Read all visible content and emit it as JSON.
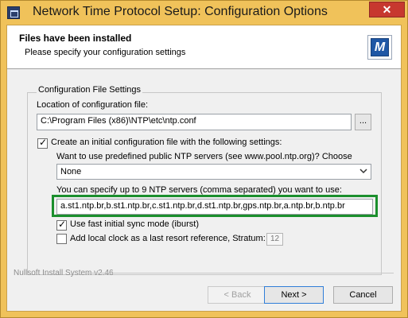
{
  "window": {
    "title": "Network Time Protocol Setup: Configuration Options",
    "close_glyph": "✕"
  },
  "header": {
    "title": "Files have been installed",
    "subtitle": "Please specify your configuration settings",
    "logo_text": "M"
  },
  "config": {
    "group_title": "Configuration File Settings",
    "location_label": "Location of configuration file:",
    "location_value": "C:\\Program Files (x86)\\NTP\\etc\\ntp.conf",
    "browse_label": "...",
    "create_checkbox_label": "Create an initial configuration file with the following settings:",
    "create_checked": true,
    "public_servers_label": "Want to use predefined public NTP servers (see www.pool.ntp.org)? Choose",
    "public_servers_value": "None",
    "servers_label": "You can specify up to 9 NTP servers (comma separated) you want to use:",
    "servers_value": "a.st1.ntp.br,b.st1.ntp.br,c.st1.ntp.br,d.st1.ntp.br,gps.ntp.br,a.ntp.br,b.ntp.br",
    "fast_sync_label": "Use fast initial sync mode (iburst)",
    "fast_sync_checked": true,
    "local_clock_label": "Add local clock as a last resort reference, Stratum:",
    "local_clock_checked": false,
    "stratum_value": "12"
  },
  "footer": {
    "installer_label": "Nullsoft Install System v2.46",
    "back_label": "< Back",
    "next_label": "Next >",
    "cancel_label": "Cancel"
  },
  "colors": {
    "titlebar": "#f0c25a",
    "highlight": "#1b8f2d",
    "close": "#c7382f"
  }
}
